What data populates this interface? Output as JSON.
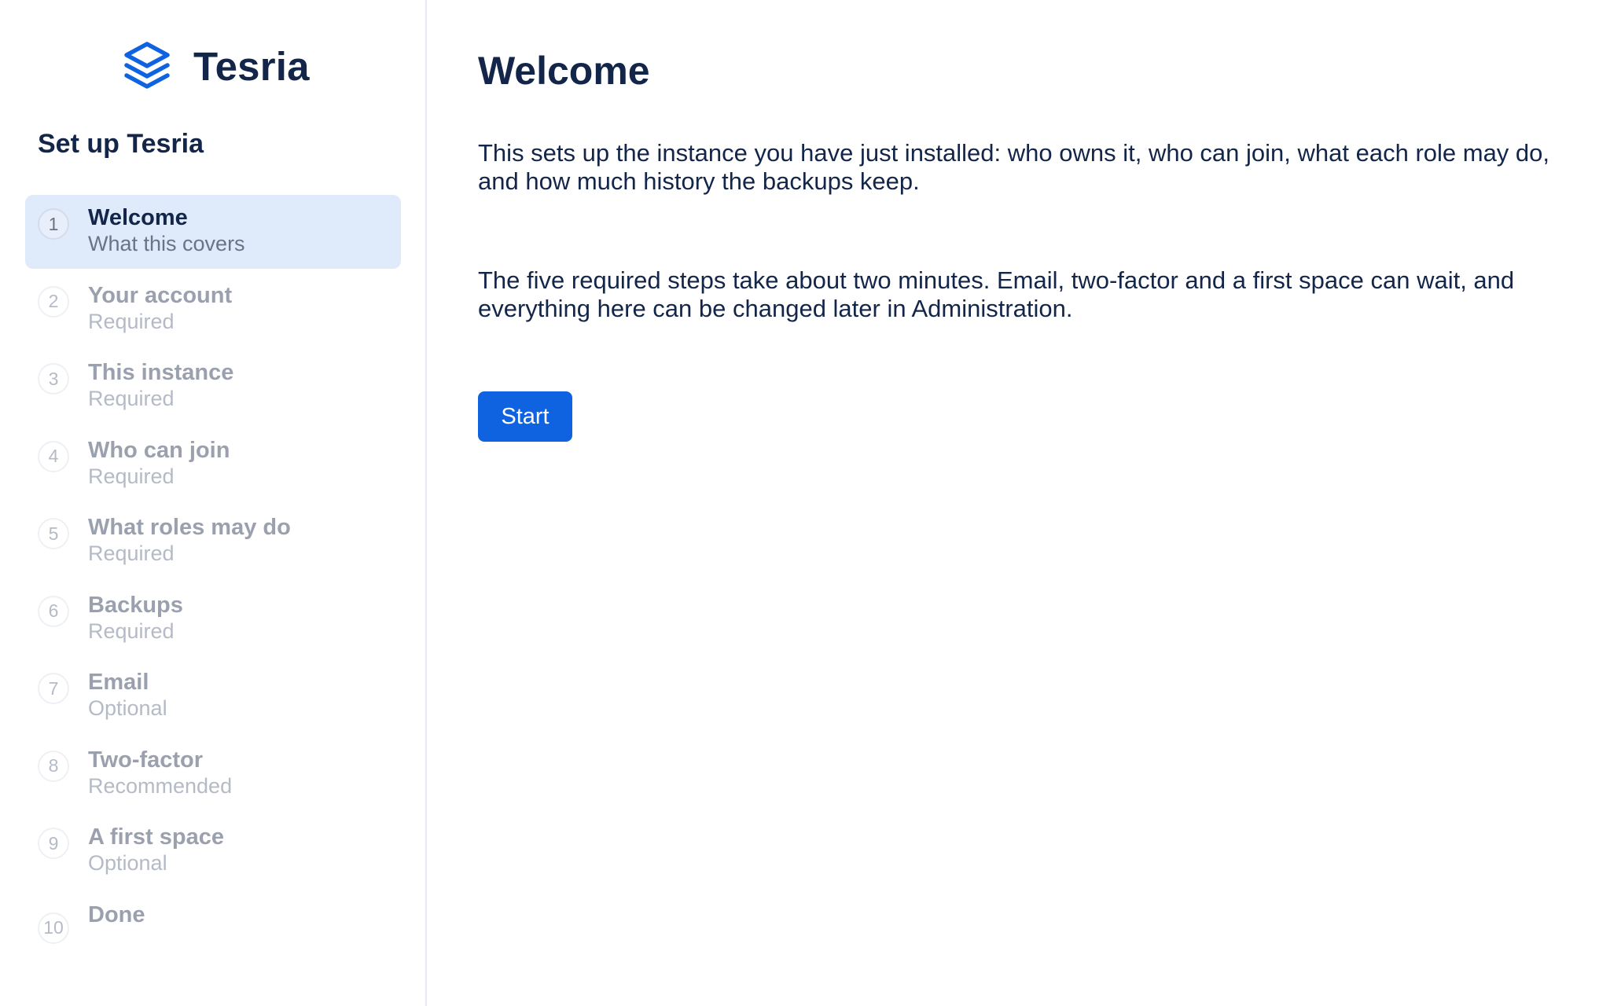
{
  "brand": {
    "name": "Tesria",
    "logo_icon": "stacked-layers-icon",
    "accent_color": "#0f62e0"
  },
  "sidebar": {
    "heading": "Set up Tesria",
    "steps": [
      {
        "number": "1",
        "title": "Welcome",
        "subtitle": "What this covers",
        "active": true
      },
      {
        "number": "2",
        "title": "Your account",
        "subtitle": "Required"
      },
      {
        "number": "3",
        "title": "This instance",
        "subtitle": "Required"
      },
      {
        "number": "4",
        "title": "Who can join",
        "subtitle": "Required"
      },
      {
        "number": "5",
        "title": "What roles may do",
        "subtitle": "Required"
      },
      {
        "number": "6",
        "title": "Backups",
        "subtitle": "Required"
      },
      {
        "number": "7",
        "title": "Email",
        "subtitle": "Optional"
      },
      {
        "number": "8",
        "title": "Two-factor",
        "subtitle": "Recommended"
      },
      {
        "number": "9",
        "title": "A first space",
        "subtitle": "Optional"
      },
      {
        "number": "10",
        "title": "Done",
        "subtitle": ""
      }
    ]
  },
  "main": {
    "title": "Welcome",
    "paragraphs": [
      "This sets up the instance you have just installed: who owns it, who can join, what each role may do, and how much history the backups keep.",
      "The five required steps take about two minutes. Email, two-factor and a first space can wait, and everything here can be changed later in Administration."
    ],
    "start_label": "Start"
  }
}
